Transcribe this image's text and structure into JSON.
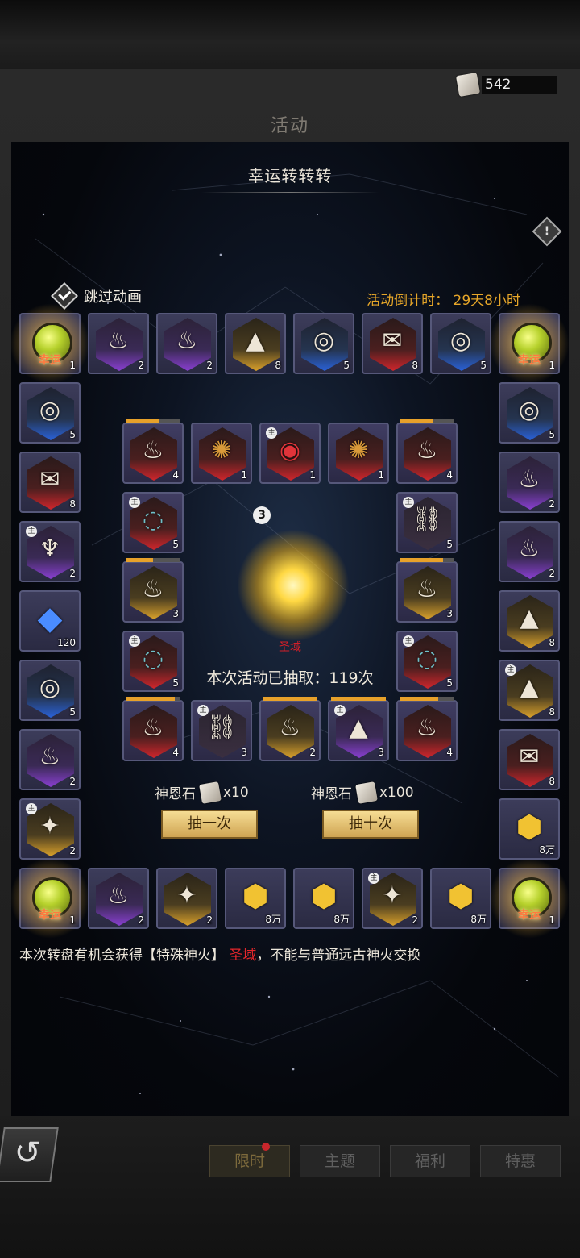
{
  "currency": {
    "value": "542"
  },
  "header": {
    "title": "活动"
  },
  "event": {
    "title": "幸运转转转",
    "skip_label": "跳过动画",
    "countdown": "活动倒计时：  29天8小时",
    "lucky_label": "幸运",
    "center_reward": "圣域",
    "center_bubble": "3",
    "draw_count": "本次活动已抽取：119次"
  },
  "draws": [
    {
      "stone": "神恩石",
      "mult": "x10",
      "button": "抽一次"
    },
    {
      "stone": "神恩石",
      "mult": "x100",
      "button": "抽十次"
    }
  ],
  "note": {
    "before": "本次转盘有机会获得【特殊神火】",
    "highlight": "圣域",
    "after": "，不能与普通远古神火交换"
  },
  "tabs": [
    {
      "label": "限时",
      "active": true
    },
    {
      "label": "主题",
      "active": false
    },
    {
      "label": "福利",
      "active": false
    },
    {
      "label": "特惠",
      "active": false
    }
  ],
  "outer_top": [
    {
      "kind": "lucky",
      "count": "1"
    },
    {
      "icon": "flame",
      "color": "purple",
      "count": "2"
    },
    {
      "icon": "flame",
      "color": "purple",
      "count": "2"
    },
    {
      "icon": "powder",
      "color": "gold",
      "count": "8"
    },
    {
      "icon": "compass",
      "color": "blue",
      "count": "5"
    },
    {
      "icon": "scroll",
      "color": "red",
      "count": "8"
    },
    {
      "icon": "compass",
      "color": "blue",
      "count": "5"
    },
    {
      "kind": "lucky",
      "count": "1"
    }
  ],
  "outer_left": [
    {
      "icon": "compass",
      "color": "blue",
      "count": "5"
    },
    {
      "icon": "scroll",
      "color": "red",
      "count": "8"
    },
    {
      "icon": "chalice",
      "color": "purple",
      "count": "2",
      "main": true
    },
    {
      "icon": "crystal",
      "color": "none",
      "count": "120"
    },
    {
      "icon": "compass",
      "color": "blue",
      "count": "5"
    },
    {
      "icon": "flame",
      "color": "purple",
      "count": "2"
    },
    {
      "icon": "bone",
      "color": "gold",
      "count": "2",
      "main": true
    }
  ],
  "outer_right": [
    {
      "icon": "compass",
      "color": "blue",
      "count": "5"
    },
    {
      "icon": "flame",
      "color": "purple",
      "count": "2"
    },
    {
      "icon": "flame",
      "color": "purple",
      "count": "2"
    },
    {
      "icon": "powder",
      "color": "gold",
      "count": "8"
    },
    {
      "icon": "powder",
      "color": "gold",
      "count": "8",
      "main": true
    },
    {
      "icon": "scroll",
      "color": "red",
      "count": "8"
    },
    {
      "icon": "gem",
      "color": "none",
      "count": "8万"
    }
  ],
  "outer_bottom": [
    {
      "kind": "lucky",
      "count": "1"
    },
    {
      "icon": "flame",
      "color": "purple",
      "count": "2"
    },
    {
      "icon": "bone",
      "color": "gold",
      "count": "2"
    },
    {
      "icon": "gem",
      "color": "none",
      "count": "8万"
    },
    {
      "icon": "gem",
      "color": "none",
      "count": "8万"
    },
    {
      "icon": "bone",
      "color": "gold",
      "count": "2",
      "main": true
    },
    {
      "icon": "gem",
      "color": "none",
      "count": "8万"
    },
    {
      "kind": "lucky",
      "count": "1"
    }
  ],
  "inner_top": [
    {
      "icon": "flame",
      "color": "red",
      "count": "4",
      "progress": 0.6
    },
    {
      "icon": "claw",
      "color": "red",
      "count": "1"
    },
    {
      "icon": "eye",
      "color": "red",
      "count": "1",
      "main": true
    },
    {
      "icon": "claw",
      "color": "red",
      "count": "1"
    },
    {
      "icon": "flame",
      "color": "red",
      "count": "4",
      "progress": 0.6
    }
  ],
  "inner_left": [
    {
      "icon": "ring",
      "color": "red",
      "count": "5",
      "main": true
    },
    {
      "icon": "flame",
      "color": "gold",
      "count": "3",
      "progress": 0.5
    },
    {
      "icon": "ring",
      "color": "red",
      "count": "5",
      "main": true
    }
  ],
  "inner_right": [
    {
      "icon": "chain",
      "color": "dark",
      "count": "5",
      "main": true
    },
    {
      "icon": "flame",
      "color": "gold",
      "count": "3",
      "progress": 0.8
    },
    {
      "icon": "ring",
      "color": "red",
      "count": "5",
      "main": true
    }
  ],
  "inner_bottom": [
    {
      "icon": "flame",
      "color": "red",
      "count": "4",
      "progress": 0.9
    },
    {
      "icon": "chain",
      "color": "dark",
      "count": "3",
      "main": true
    },
    {
      "icon": "flame",
      "color": "gold",
      "count": "2",
      "progress": 1
    },
    {
      "icon": "powder",
      "color": "purple",
      "count": "3",
      "main": true,
      "progress": 1
    },
    {
      "icon": "flame",
      "color": "red",
      "count": "4",
      "progress": 0.7
    }
  ],
  "colors": {
    "accent": "#e6a629",
    "highlight_red": "#e4262b"
  }
}
